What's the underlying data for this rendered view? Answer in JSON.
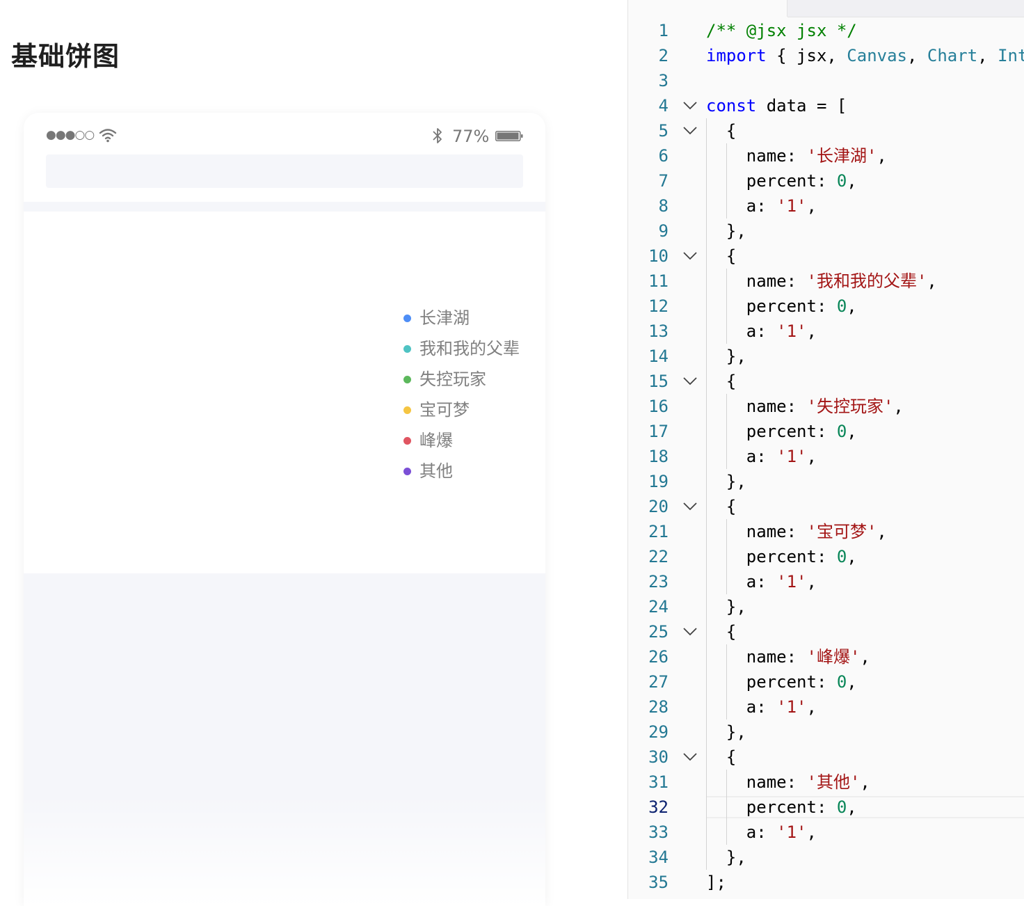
{
  "demo": {
    "title": "基础饼图",
    "status_bar": {
      "signal": "●●●○○",
      "battery": "77%"
    },
    "legend": [
      {
        "name": "长津湖",
        "color": "#4e8ef6"
      },
      {
        "name": "我和我的父辈",
        "color": "#4fc3c3"
      },
      {
        "name": "失控玩家",
        "color": "#5cb85c"
      },
      {
        "name": "宝可梦",
        "color": "#f5c542"
      },
      {
        "name": "峰爆",
        "color": "#e05561"
      },
      {
        "name": "其他",
        "color": "#7b4fd6"
      }
    ]
  },
  "editor": {
    "current_line": 32,
    "lines": [
      "/** @jsx jsx */",
      "import { jsx, Canvas, Chart, Int",
      "",
      "const data = [",
      "  {",
      "    name: '长津湖',",
      "    percent: 0,",
      "    a: '1',",
      "  },",
      "  {",
      "    name: '我和我的父辈',",
      "    percent: 0,",
      "    a: '1',",
      "  },",
      "  {",
      "    name: '失控玩家',",
      "    percent: 0,",
      "    a: '1',",
      "  },",
      "  {",
      "    name: '宝可梦',",
      "    percent: 0,",
      "    a: '1',",
      "  },",
      "  {",
      "    name: '峰爆',",
      "    percent: 0,",
      "    a: '1',",
      "  },",
      "  {",
      "    name: '其他',",
      "    percent: 0,",
      "    a: '1',",
      "  },",
      "];"
    ],
    "foldable_lines": [
      4,
      5,
      10,
      15,
      20,
      25,
      30
    ]
  }
}
